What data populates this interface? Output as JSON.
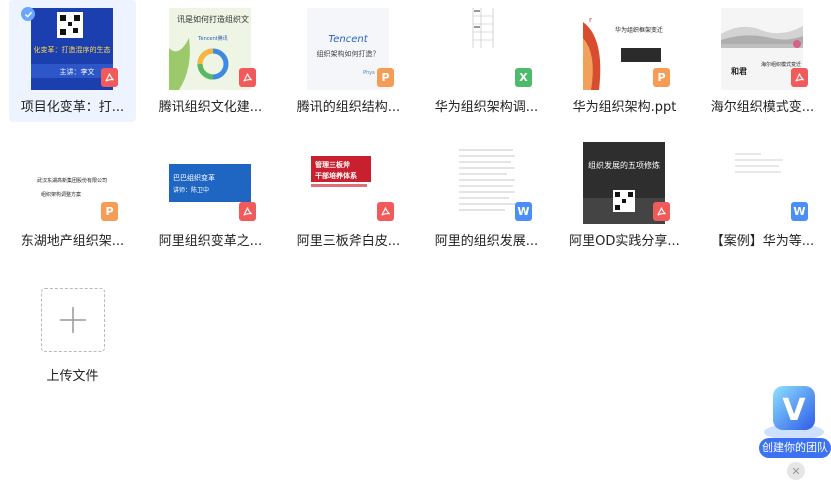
{
  "files": [
    {
      "name": "项目化变革：打...",
      "type": "pdf",
      "thumb_text": [
        "化变革：打造混序的生态",
        "主讲：李文"
      ],
      "selected": true
    },
    {
      "name": "腾讯组织文化建...",
      "type": "pdf",
      "thumb_text": [
        "讯是如何打造组织文",
        "Tencent腾讯"
      ]
    },
    {
      "name": "腾讯的组织结构...",
      "type": "ppt",
      "thumb_text": [
        "Tencent",
        "组织架构如何打造？",
        "Phys"
      ]
    },
    {
      "name": "华为组织架构调...",
      "type": "xls",
      "thumb_text": []
    },
    {
      "name": "华为组织架构.ppt",
      "type": "ppt",
      "thumb_text": [
        "华为组织框架变迁"
      ]
    },
    {
      "name": "海尔组织模式变...",
      "type": "pdf",
      "thumb_text": [
        "和君",
        "海尔组织模式变迁"
      ]
    },
    {
      "name": "东湖地产组织架...",
      "type": "ppt",
      "thumb_text": [
        "武汉东湖高新集团股份有限公司",
        "组织架构调整方案"
      ]
    },
    {
      "name": "阿里组织变革之...",
      "type": "pdf",
      "thumb_text": [
        "巴巴组织变革",
        "讲师：陈卫中"
      ]
    },
    {
      "name": "阿里三板斧白皮...",
      "type": "pdf",
      "thumb_text": [
        "管理三板斧",
        "干部培养体系"
      ]
    },
    {
      "name": "阿里的组织发展...",
      "type": "doc",
      "thumb_text": []
    },
    {
      "name": "阿里OD实践分享...",
      "type": "pdf",
      "thumb_text": [
        "组织发展的五项修炼"
      ]
    },
    {
      "name": "【案例】华为等...",
      "type": "doc",
      "thumb_text": []
    }
  ],
  "upload": {
    "label": "上传文件"
  },
  "team_badge": {
    "label": "创建你的团队",
    "letter": "V"
  },
  "colors": {
    "pdf": "#f05a5a",
    "ppt": "#f59d57",
    "xls": "#4cbb6a",
    "doc": "#4b8ef7",
    "accent": "#3c72f2"
  }
}
